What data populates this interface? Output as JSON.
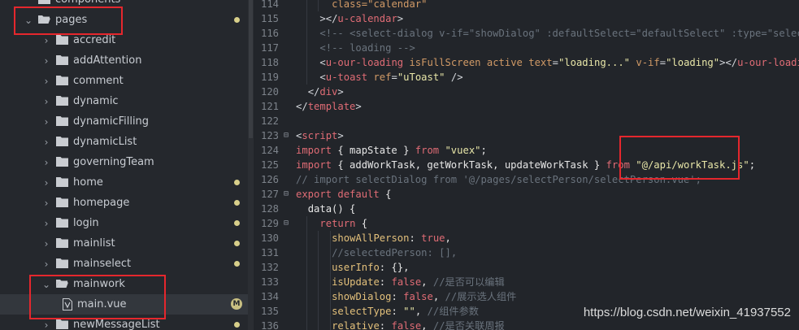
{
  "sidebar": {
    "items": [
      {
        "label": "components",
        "arrow": "",
        "type": "folder",
        "open": false,
        "dot": false,
        "badge": ""
      },
      {
        "label": "pages",
        "arrow": "⌄",
        "type": "folder",
        "open": true,
        "dot": true,
        "badge": ""
      },
      {
        "label": "accredit",
        "arrow": "›",
        "type": "folder",
        "open": false,
        "dot": false,
        "badge": ""
      },
      {
        "label": "addAttention",
        "arrow": "›",
        "type": "folder",
        "open": false,
        "dot": false,
        "badge": ""
      },
      {
        "label": "comment",
        "arrow": "›",
        "type": "folder",
        "open": false,
        "dot": false,
        "badge": ""
      },
      {
        "label": "dynamic",
        "arrow": "›",
        "type": "folder",
        "open": false,
        "dot": false,
        "badge": ""
      },
      {
        "label": "dynamicFilling",
        "arrow": "›",
        "type": "folder",
        "open": false,
        "dot": false,
        "badge": ""
      },
      {
        "label": "dynamicList",
        "arrow": "›",
        "type": "folder",
        "open": false,
        "dot": false,
        "badge": ""
      },
      {
        "label": "governingTeam",
        "arrow": "›",
        "type": "folder",
        "open": false,
        "dot": false,
        "badge": ""
      },
      {
        "label": "home",
        "arrow": "›",
        "type": "folder",
        "open": false,
        "dot": true,
        "badge": ""
      },
      {
        "label": "homepage",
        "arrow": "›",
        "type": "folder",
        "open": false,
        "dot": true,
        "badge": ""
      },
      {
        "label": "login",
        "arrow": "›",
        "type": "folder",
        "open": false,
        "dot": true,
        "badge": ""
      },
      {
        "label": "mainlist",
        "arrow": "›",
        "type": "folder",
        "open": false,
        "dot": true,
        "badge": ""
      },
      {
        "label": "mainselect",
        "arrow": "›",
        "type": "folder",
        "open": false,
        "dot": true,
        "badge": ""
      },
      {
        "label": "mainwork",
        "arrow": "⌄",
        "type": "folder",
        "open": true,
        "dot": false,
        "badge": ""
      },
      {
        "label": "main.vue",
        "arrow": "",
        "type": "file",
        "open": false,
        "dot": false,
        "badge": "M"
      },
      {
        "label": "newMessageList",
        "arrow": "›",
        "type": "folder",
        "open": false,
        "dot": true,
        "badge": ""
      }
    ]
  },
  "editor": {
    "lines": [
      {
        "n": "114",
        "fold": "",
        "indent": 3,
        "tokens": [
          {
            "t": "class=\"calendar\"",
            "c": "attr"
          }
        ]
      },
      {
        "n": "115",
        "fold": "",
        "indent": 2,
        "tokens": [
          {
            "t": "></",
            "c": "punct"
          },
          {
            "t": "u-calendar",
            "c": "tag"
          },
          {
            "t": ">",
            "c": "punct"
          }
        ]
      },
      {
        "n": "116",
        "fold": "",
        "indent": 2,
        "tokens": [
          {
            "t": "<!-- <select-dialog v-if=\"showDialog\" :defaultSelect=\"defaultSelect\" :type=\"selectTyp",
            "c": "comment"
          }
        ]
      },
      {
        "n": "117",
        "fold": "",
        "indent": 2,
        "tokens": [
          {
            "t": "<!-- loading -->",
            "c": "comment"
          }
        ]
      },
      {
        "n": "118",
        "fold": "",
        "indent": 2,
        "tokens": [
          {
            "t": "<",
            "c": "punct"
          },
          {
            "t": "u-our-loading",
            "c": "tag"
          },
          {
            "t": " ",
            "c": "text"
          },
          {
            "t": "isFullScreen",
            "c": "attr"
          },
          {
            "t": " ",
            "c": "text"
          },
          {
            "t": "active",
            "c": "attr"
          },
          {
            "t": " ",
            "c": "text"
          },
          {
            "t": "text",
            "c": "attr"
          },
          {
            "t": "=",
            "c": "punct"
          },
          {
            "t": "\"loading...\"",
            "c": "str"
          },
          {
            "t": " ",
            "c": "text"
          },
          {
            "t": "v-if",
            "c": "attr"
          },
          {
            "t": "=",
            "c": "punct"
          },
          {
            "t": "\"loading\"",
            "c": "str"
          },
          {
            "t": "></",
            "c": "punct"
          },
          {
            "t": "u-our-loading",
            "c": "tag"
          },
          {
            "t": ">",
            "c": "punct"
          }
        ]
      },
      {
        "n": "119",
        "fold": "",
        "indent": 2,
        "tokens": [
          {
            "t": "<",
            "c": "punct"
          },
          {
            "t": "u-toast",
            "c": "tag"
          },
          {
            "t": " ",
            "c": "text"
          },
          {
            "t": "ref",
            "c": "attr"
          },
          {
            "t": "=",
            "c": "punct"
          },
          {
            "t": "\"uToast\"",
            "c": "str"
          },
          {
            "t": " />",
            "c": "punct"
          }
        ]
      },
      {
        "n": "120",
        "fold": "",
        "indent": 1,
        "tokens": [
          {
            "t": "</",
            "c": "punct"
          },
          {
            "t": "div",
            "c": "tag"
          },
          {
            "t": ">",
            "c": "punct"
          }
        ]
      },
      {
        "n": "121",
        "fold": "",
        "indent": 0,
        "tokens": [
          {
            "t": "</",
            "c": "punct"
          },
          {
            "t": "template",
            "c": "tag"
          },
          {
            "t": ">",
            "c": "punct"
          }
        ]
      },
      {
        "n": "122",
        "fold": "",
        "indent": 0,
        "tokens": []
      },
      {
        "n": "123",
        "fold": "⊟",
        "indent": 0,
        "tokens": [
          {
            "t": "<",
            "c": "punct"
          },
          {
            "t": "script",
            "c": "tag"
          },
          {
            "t": ">",
            "c": "punct"
          }
        ]
      },
      {
        "n": "124",
        "fold": "",
        "indent": 0,
        "tokens": [
          {
            "t": "import",
            "c": "kw"
          },
          {
            "t": " { mapState } ",
            "c": "plain"
          },
          {
            "t": "from",
            "c": "kw"
          },
          {
            "t": " ",
            "c": "plain"
          },
          {
            "t": "\"vuex\"",
            "c": "str"
          },
          {
            "t": ";",
            "c": "plain"
          }
        ]
      },
      {
        "n": "125",
        "fold": "",
        "indent": 0,
        "tokens": [
          {
            "t": "import",
            "c": "kw"
          },
          {
            "t": " { addWorkTask, getWorkTask, updateWorkTask } ",
            "c": "plain"
          },
          {
            "t": "from",
            "c": "kw"
          },
          {
            "t": " ",
            "c": "plain"
          },
          {
            "t": "\"@/api/workTask.js\"",
            "c": "str"
          },
          {
            "t": ";",
            "c": "plain"
          }
        ]
      },
      {
        "n": "126",
        "fold": "",
        "indent": 0,
        "tokens": [
          {
            "t": "// import selectDialog from '@/pages/selectPerson/selectPerson.vue';",
            "c": "comment"
          }
        ]
      },
      {
        "n": "127",
        "fold": "⊟",
        "indent": 0,
        "tokens": [
          {
            "t": "export",
            "c": "kw"
          },
          {
            "t": " ",
            "c": "plain"
          },
          {
            "t": "default",
            "c": "kw"
          },
          {
            "t": " {",
            "c": "plain"
          }
        ]
      },
      {
        "n": "128",
        "fold": "",
        "indent": 1,
        "tokens": [
          {
            "t": "data() {",
            "c": "plain"
          }
        ]
      },
      {
        "n": "129",
        "fold": "⊟",
        "indent": 2,
        "tokens": [
          {
            "t": "return",
            "c": "kw"
          },
          {
            "t": " {",
            "c": "plain"
          }
        ]
      },
      {
        "n": "130",
        "fold": "",
        "indent": 3,
        "tokens": [
          {
            "t": "showAllPerson",
            "c": "prop"
          },
          {
            "t": ": ",
            "c": "plain"
          },
          {
            "t": "true",
            "c": "kw"
          },
          {
            "t": ",",
            "c": "plain"
          }
        ]
      },
      {
        "n": "131",
        "fold": "",
        "indent": 3,
        "tokens": [
          {
            "t": "//selectedPerson: [],",
            "c": "comment"
          }
        ]
      },
      {
        "n": "132",
        "fold": "",
        "indent": 3,
        "tokens": [
          {
            "t": "userInfo",
            "c": "prop"
          },
          {
            "t": ": {},",
            "c": "plain"
          }
        ]
      },
      {
        "n": "133",
        "fold": "",
        "indent": 3,
        "tokens": [
          {
            "t": "isUpdate",
            "c": "prop"
          },
          {
            "t": ": ",
            "c": "plain"
          },
          {
            "t": "false",
            "c": "kw"
          },
          {
            "t": ", ",
            "c": "plain"
          },
          {
            "t": "//是否可以编辑",
            "c": "comment"
          }
        ]
      },
      {
        "n": "134",
        "fold": "",
        "indent": 3,
        "tokens": [
          {
            "t": "showDialog",
            "c": "prop"
          },
          {
            "t": ": ",
            "c": "plain"
          },
          {
            "t": "false",
            "c": "kw"
          },
          {
            "t": ", ",
            "c": "plain"
          },
          {
            "t": "//展示选人组件",
            "c": "comment"
          }
        ]
      },
      {
        "n": "135",
        "fold": "",
        "indent": 3,
        "tokens": [
          {
            "t": "selectType",
            "c": "prop"
          },
          {
            "t": ": ",
            "c": "plain"
          },
          {
            "t": "\"\"",
            "c": "str"
          },
          {
            "t": ", ",
            "c": "plain"
          },
          {
            "t": "//组件参数",
            "c": "comment"
          }
        ]
      },
      {
        "n": "136",
        "fold": "",
        "indent": 3,
        "tokens": [
          {
            "t": "relative",
            "c": "prop"
          },
          {
            "t": ": ",
            "c": "plain"
          },
          {
            "t": "false",
            "c": "kw"
          },
          {
            "t": ", ",
            "c": "plain"
          },
          {
            "t": "//是否关联周报",
            "c": "comment"
          }
        ]
      }
    ]
  },
  "watermark": "https://blog.csdn.net/weixin_41937552",
  "colors": {
    "highlight": "#e5272d",
    "dot": "#d8cf8a",
    "background": "#22252a"
  }
}
